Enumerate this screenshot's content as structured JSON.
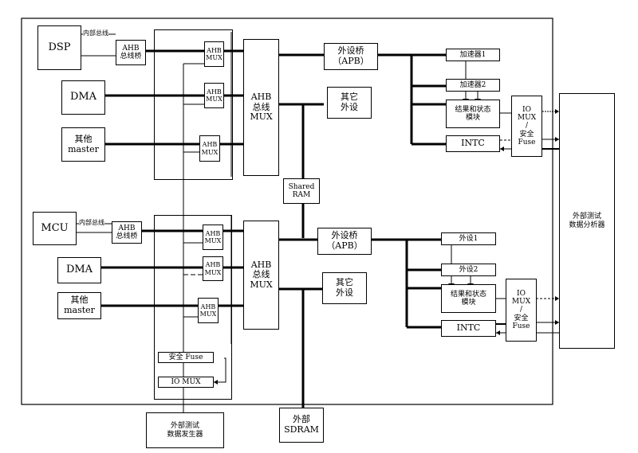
{
  "diagram": {
    "top_system": {
      "masters": [
        {
          "name": "DSP"
        },
        {
          "name": "DMA"
        },
        {
          "name_line1": "其他",
          "name_line2": "master"
        }
      ],
      "internal_bus_label": "内部总线",
      "ahb_bridge": {
        "line1": "AHB",
        "line2": "总线桥"
      },
      "ahb_mux_small": {
        "line1": "AHB",
        "line2": "MUX"
      },
      "ahb_bus_mux": {
        "line1": "AHB",
        "line2": "总线",
        "line3": "MUX"
      },
      "apb_bridge": {
        "line1": "外设桥",
        "line2": "（APB）"
      },
      "other_peripheral": {
        "line1": "其它",
        "line2": "外设"
      },
      "accelerator1": "加速器1",
      "accelerator2": "加速器2",
      "result_status": {
        "line1": "结果和状态",
        "line2": "模块"
      },
      "intc": "INTC",
      "io_mux_fuse": {
        "line1": "IO",
        "line2": "MUX",
        "line3": "/",
        "line4": "安全",
        "line5": "Fuse"
      }
    },
    "shared_ram": {
      "line1": "Shared",
      "line2": "RAM"
    },
    "bottom_system": {
      "masters": [
        {
          "name": "MCU"
        },
        {
          "name": "DMA"
        },
        {
          "name_line1": "其他",
          "name_line2": "master"
        }
      ],
      "internal_bus_label": "内部总线",
      "ahb_bridge": {
        "line1": "AHB",
        "line2": "总线桥"
      },
      "ahb_mux_small": {
        "line1": "AHB",
        "line2": "MUX"
      },
      "ahb_bus_mux": {
        "line1": "AHB",
        "line2": "总线",
        "line3": "MUX"
      },
      "apb_bridge": {
        "line1": "外设桥",
        "line2": "（APB）"
      },
      "other_peripheral": {
        "line1": "其它",
        "line2": "外设"
      },
      "peripheral1": "外设1",
      "peripheral2": "外设2",
      "result_status": {
        "line1": "结果和状态",
        "line2": "模块"
      },
      "intc": "INTC",
      "io_mux_fuse": {
        "line1": "IO",
        "line2": "MUX",
        "line3": "/",
        "line4": "安全",
        "line5": "Fuse"
      },
      "safety_fuse": "安全 Fuse",
      "io_mux": "IO MUX"
    },
    "external_test_analyzer": {
      "line1": "外部测试",
      "line2": "数据分析器"
    },
    "external_test_generator": {
      "line1": "外部测试",
      "line2": "数据发生器"
    },
    "external_sdram": {
      "line1": "外部",
      "line2": "SDRAM"
    }
  }
}
